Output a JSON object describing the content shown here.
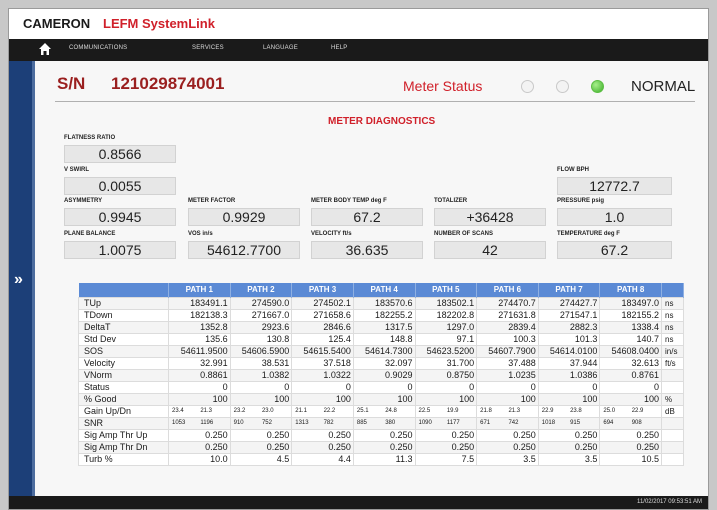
{
  "app": {
    "brand": "CAMERON",
    "product": "LEFM SystemLink"
  },
  "nav": {
    "items": [
      "COMMUNICATIONS",
      "SERVICES",
      "LANGUAGE",
      "HELP"
    ]
  },
  "header": {
    "sn_label": "S/N",
    "sn_value": "121029874001",
    "meter_status_label": "Meter Status",
    "meter_status_value": "NORMAL"
  },
  "diagnostics": {
    "title": "METER DIAGNOSTICS",
    "flatness_ratio": {
      "label": "FLATNESS RATIO",
      "value": "0.8566"
    },
    "v_swirl": {
      "label": "V SWIRL",
      "value": "0.0055"
    },
    "asymmetry": {
      "label": "ASYMMETRY",
      "value": "0.9945"
    },
    "plane_balance": {
      "label": "PLANE BALANCE",
      "value": "1.0075"
    },
    "meter_factor": {
      "label": "METER FACTOR",
      "value": "0.9929"
    },
    "vos": {
      "label": "VOS in/s",
      "value": "54612.7700"
    },
    "meter_body_temp": {
      "label": "METER BODY TEMP deg F",
      "value": "67.2"
    },
    "velocity": {
      "label": "VELOCITY ft/s",
      "value": "36.635"
    },
    "totalizer": {
      "label": "TOTALIZER",
      "value": "+36428"
    },
    "number_of_scans": {
      "label": "NUMBER OF SCANS",
      "value": "42"
    },
    "flow_bph": {
      "label": "FLOW BPH",
      "value": "12772.7"
    },
    "pressure": {
      "label": "PRESSURE psig",
      "value": "1.0"
    },
    "temperature": {
      "label": "TEMPERATURE deg F",
      "value": "67.2"
    }
  },
  "table": {
    "headers": [
      "PATH 1",
      "PATH 2",
      "PATH 3",
      "PATH 4",
      "PATH 5",
      "PATH 6",
      "PATH 7",
      "PATH 8"
    ],
    "rows": [
      {
        "label": "TUp",
        "unit": "ns",
        "values": [
          "183491.1",
          "274590.0",
          "274502.1",
          "183570.6",
          "183502.1",
          "274470.7",
          "274427.7",
          "183497.0"
        ]
      },
      {
        "label": "TDown",
        "unit": "ns",
        "values": [
          "182138.3",
          "271667.0",
          "271658.6",
          "182255.2",
          "182202.8",
          "271631.8",
          "271547.1",
          "182155.2"
        ]
      },
      {
        "label": "DeltaT",
        "unit": "ns",
        "values": [
          "1352.8",
          "2923.6",
          "2846.6",
          "1317.5",
          "1297.0",
          "2839.4",
          "2882.3",
          "1338.4"
        ]
      },
      {
        "label": "Std Dev",
        "unit": "ns",
        "values": [
          "135.6",
          "130.8",
          "125.4",
          "148.8",
          "97.1",
          "100.3",
          "101.3",
          "140.7"
        ]
      },
      {
        "label": "SOS",
        "unit": "in/s",
        "values": [
          "54611.9500",
          "54606.5900",
          "54615.5400",
          "54614.7300",
          "54623.5200",
          "54607.7900",
          "54614.0100",
          "54608.0400"
        ]
      },
      {
        "label": "Velocity",
        "unit": "ft/s",
        "values": [
          "32.991",
          "38.531",
          "37.518",
          "32.097",
          "31.700",
          "37.488",
          "37.944",
          "32.613"
        ]
      },
      {
        "label": "VNorm",
        "unit": "",
        "values": [
          "0.8861",
          "1.0382",
          "1.0322",
          "0.9029",
          "0.8750",
          "1.0235",
          "1.0386",
          "0.8761"
        ]
      },
      {
        "label": "Status",
        "unit": "",
        "values": [
          "0",
          "0",
          "0",
          "0",
          "0",
          "0",
          "0",
          "0"
        ]
      },
      {
        "label": "% Good",
        "unit": "%",
        "values": [
          "100",
          "100",
          "100",
          "100",
          "100",
          "100",
          "100",
          "100"
        ]
      },
      {
        "label": "Gain Up/Dn",
        "unit": "dB",
        "pairs": [
          [
            "23.4",
            "21.3"
          ],
          [
            "23.2",
            "23.0"
          ],
          [
            "21.1",
            "22.2"
          ],
          [
            "25.1",
            "24.8"
          ],
          [
            "22.5",
            "19.9"
          ],
          [
            "21.8",
            "21.3"
          ],
          [
            "22.9",
            "23.8"
          ],
          [
            "25.0",
            "22.9"
          ]
        ]
      },
      {
        "label": "SNR",
        "unit": "",
        "pairs": [
          [
            "1053",
            "1196"
          ],
          [
            "910",
            "752"
          ],
          [
            "1313",
            "782"
          ],
          [
            "885",
            "380"
          ],
          [
            "1090",
            "1177"
          ],
          [
            "671",
            "742"
          ],
          [
            "1018",
            "915"
          ],
          [
            "694",
            "908"
          ]
        ]
      },
      {
        "label": "Sig Amp Thr Up",
        "unit": "",
        "values": [
          "0.250",
          "0.250",
          "0.250",
          "0.250",
          "0.250",
          "0.250",
          "0.250",
          "0.250"
        ]
      },
      {
        "label": "Sig Amp Thr Dn",
        "unit": "",
        "values": [
          "0.250",
          "0.250",
          "0.250",
          "0.250",
          "0.250",
          "0.250",
          "0.250",
          "0.250"
        ]
      },
      {
        "label": "Turb %",
        "unit": "",
        "values": [
          "10.0",
          "4.5",
          "4.4",
          "11.3",
          "7.5",
          "3.5",
          "3.5",
          "10.5"
        ]
      }
    ]
  },
  "statusbar": {
    "timestamp": "11/02/2017 09:53:51 AM"
  },
  "colors": {
    "brand_red": "#d0202a",
    "header_blue": "#5b8ad5",
    "sidebar_blue": "#1c3f78",
    "status_ok": "#3eae2a"
  }
}
